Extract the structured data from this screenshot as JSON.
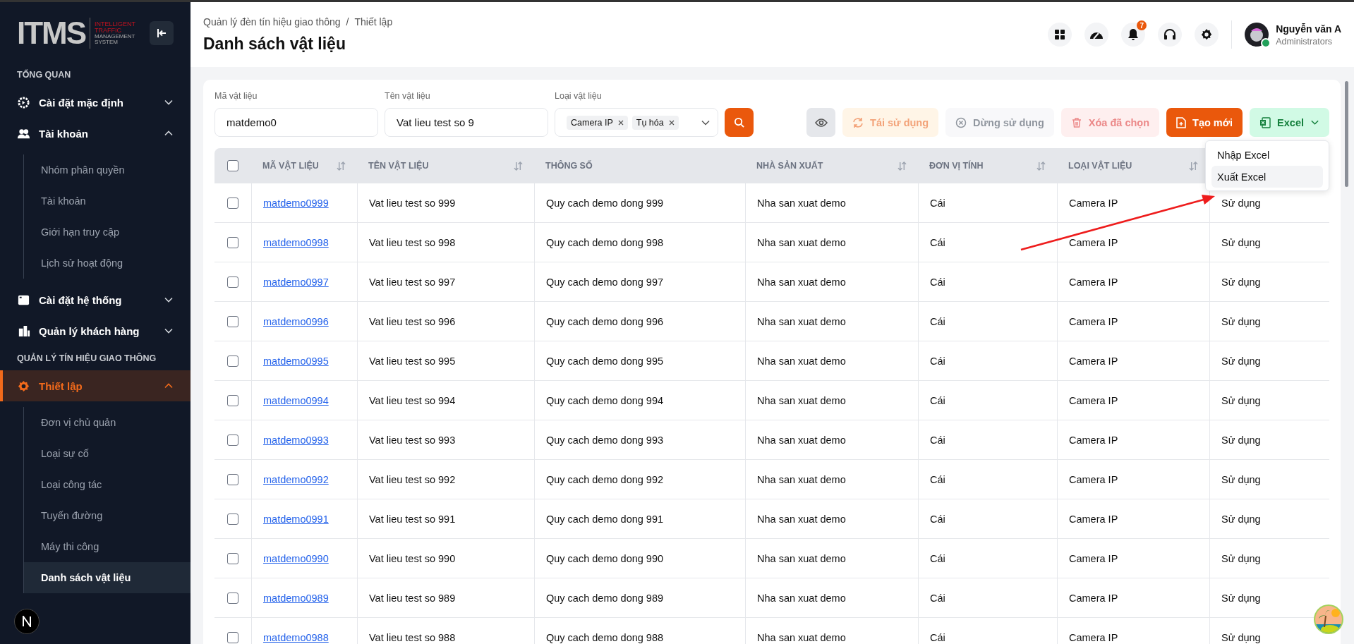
{
  "logo": {
    "mark": "ITMS",
    "lines": [
      "INTELLIGENT",
      "TRAFFIC",
      "MANAGEMENT",
      "SYSTEM"
    ]
  },
  "sidebar": {
    "sections": [
      {
        "title": "TỔNG QUAN",
        "items": [
          {
            "label": "Cài đặt mặc định",
            "expanded": false,
            "selected": false
          },
          {
            "label": "Tài khoản",
            "expanded": true,
            "selected": false,
            "children": [
              {
                "label": "Nhóm phân quyền",
                "selected": false
              },
              {
                "label": "Tài khoản",
                "selected": false
              },
              {
                "label": "Giới hạn truy cập",
                "selected": false
              },
              {
                "label": "Lịch sử hoạt động",
                "selected": false
              }
            ]
          },
          {
            "label": "Cài đặt hệ thống",
            "expanded": false,
            "selected": false
          },
          {
            "label": "Quản lý khách hàng",
            "expanded": false,
            "selected": false
          }
        ]
      },
      {
        "title": "QUẢN LÝ TÍN HIỆU GIAO THÔNG",
        "items": [
          {
            "label": "Thiết lập",
            "expanded": true,
            "selected": true,
            "children": [
              {
                "label": "Đơn vị chủ quản",
                "selected": false
              },
              {
                "label": "Loại sự cố",
                "selected": false
              },
              {
                "label": "Loại công tác",
                "selected": false
              },
              {
                "label": "Tuyến đường",
                "selected": false
              },
              {
                "label": "Máy thi công",
                "selected": false
              },
              {
                "label": "Danh sách vật liệu",
                "selected": true
              }
            ]
          }
        ]
      }
    ]
  },
  "header": {
    "breadcrumb": [
      "Quản lý đèn tín hiệu giao thông",
      "Thiết lập"
    ],
    "separator": "/",
    "title": "Danh sách vật liệu",
    "notification_count": "7",
    "user": {
      "name": "Nguyễn văn A",
      "role": "Administrators",
      "online": true
    }
  },
  "filters": [
    {
      "label": "Mã vật liệu",
      "value": "matdemo0"
    },
    {
      "label": "Tên vật liệu",
      "value": "Vat lieu test so 9"
    }
  ],
  "type_filter": {
    "label": "Loại vật liệu",
    "tags": [
      "Camera IP",
      "Tụ hóa"
    ]
  },
  "buttons": [
    {
      "kind": "view",
      "disabled": false
    },
    {
      "kind": "reuse",
      "label": "Tái sử dụng",
      "disabled": true
    },
    {
      "kind": "stop",
      "label": "Dừng sử dụng",
      "disabled": true
    },
    {
      "kind": "delete",
      "label": "Xóa đã chọn",
      "disabled": true
    },
    {
      "kind": "create",
      "label": "Tạo mới",
      "disabled": false
    },
    {
      "kind": "excel",
      "label": "Excel",
      "disabled": false
    }
  ],
  "excel_menu": [
    {
      "label": "Nhập Excel",
      "selected": false
    },
    {
      "label": "Xuất Excel",
      "selected": true
    }
  ],
  "table": {
    "select_all_checked": false,
    "columns": [
      {
        "label": "MÃ VẬT LIỆU",
        "sortable": true
      },
      {
        "label": "TÊN VẬT LIỆU",
        "sortable": true
      },
      {
        "label": "THÔNG SỐ",
        "sortable": false
      },
      {
        "label": "NHÀ SẢN XUẤT",
        "sortable": true
      },
      {
        "label": "ĐƠN VỊ TÍNH",
        "sortable": true
      },
      {
        "label": "LOẠI VẬT LIỆU",
        "sortable": true
      }
    ],
    "rows": [
      {
        "checked": false,
        "cells": [
          "matdemo0999",
          "Vat lieu test so 999",
          "Quy cach demo dong 999",
          "Nha san xuat demo",
          "Cái",
          "Camera IP",
          "Sử dụng"
        ]
      },
      {
        "checked": false,
        "cells": [
          "matdemo0998",
          "Vat lieu test so 998",
          "Quy cach demo dong 998",
          "Nha san xuat demo",
          "Cái",
          "Camera IP",
          "Sử dụng"
        ]
      },
      {
        "checked": false,
        "cells": [
          "matdemo0997",
          "Vat lieu test so 997",
          "Quy cach demo dong 997",
          "Nha san xuat demo",
          "Cái",
          "Camera IP",
          "Sử dụng"
        ]
      },
      {
        "checked": false,
        "cells": [
          "matdemo0996",
          "Vat lieu test so 996",
          "Quy cach demo dong 996",
          "Nha san xuat demo",
          "Cái",
          "Camera IP",
          "Sử dụng"
        ]
      },
      {
        "checked": false,
        "cells": [
          "matdemo0995",
          "Vat lieu test so 995",
          "Quy cach demo dong 995",
          "Nha san xuat demo",
          "Cái",
          "Camera IP",
          "Sử dụng"
        ]
      },
      {
        "checked": false,
        "cells": [
          "matdemo0994",
          "Vat lieu test so 994",
          "Quy cach demo dong 994",
          "Nha san xuat demo",
          "Cái",
          "Camera IP",
          "Sử dụng"
        ]
      },
      {
        "checked": false,
        "cells": [
          "matdemo0993",
          "Vat lieu test so 993",
          "Quy cach demo dong 993",
          "Nha san xuat demo",
          "Cái",
          "Camera IP",
          "Sử dụng"
        ]
      },
      {
        "checked": false,
        "cells": [
          "matdemo0992",
          "Vat lieu test so 992",
          "Quy cach demo dong 992",
          "Nha san xuat demo",
          "Cái",
          "Camera IP",
          "Sử dụng"
        ]
      },
      {
        "checked": false,
        "cells": [
          "matdemo0991",
          "Vat lieu test so 991",
          "Quy cach demo dong 991",
          "Nha san xuat demo",
          "Cái",
          "Camera IP",
          "Sử dụng"
        ]
      },
      {
        "checked": false,
        "cells": [
          "matdemo0990",
          "Vat lieu test so 990",
          "Quy cach demo dong 990",
          "Nha san xuat demo",
          "Cái",
          "Camera IP",
          "Sử dụng"
        ]
      },
      {
        "checked": false,
        "cells": [
          "matdemo0989",
          "Vat lieu test so 989",
          "Quy cach demo dong 989",
          "Nha san xuat demo",
          "Cái",
          "Camera IP",
          "Sử dụng"
        ]
      },
      {
        "checked": false,
        "cells": [
          "matdemo0988",
          "Vat lieu test so 988",
          "Quy cach demo dong 988",
          "Nha san xuat demo",
          "Cái",
          "Camera IP",
          "Sử dụng"
        ]
      }
    ]
  }
}
